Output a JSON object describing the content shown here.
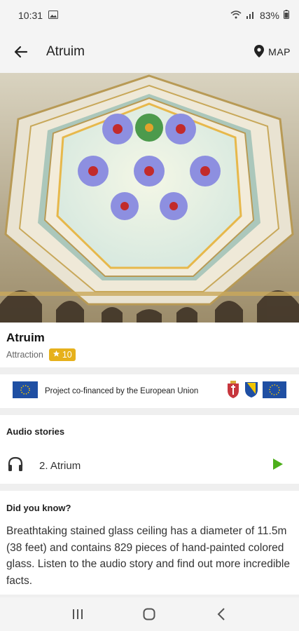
{
  "status": {
    "time": "10:31",
    "battery": "83%"
  },
  "appbar": {
    "title": "Atruim",
    "map_label": "MAP"
  },
  "place": {
    "name": "Atruim",
    "category": "Attraction",
    "rating": "10"
  },
  "eu": {
    "text": "Project co-financed by the European Union"
  },
  "audio": {
    "section_title": "Audio stories",
    "items": [
      {
        "label": "2. Atrium"
      }
    ]
  },
  "fact": {
    "title": "Did you know?",
    "text": "Breathtaking stained glass ceiling has a diameter of 11.5m (38 feet) and contains 829 pieces of hand-painted colored glass. Listen to the audio story and find out more incredible facts."
  },
  "colors": {
    "accent_play": "#4caf1a",
    "rating_bg": "#e6b11c",
    "eu_blue": "#1f4fa3"
  }
}
